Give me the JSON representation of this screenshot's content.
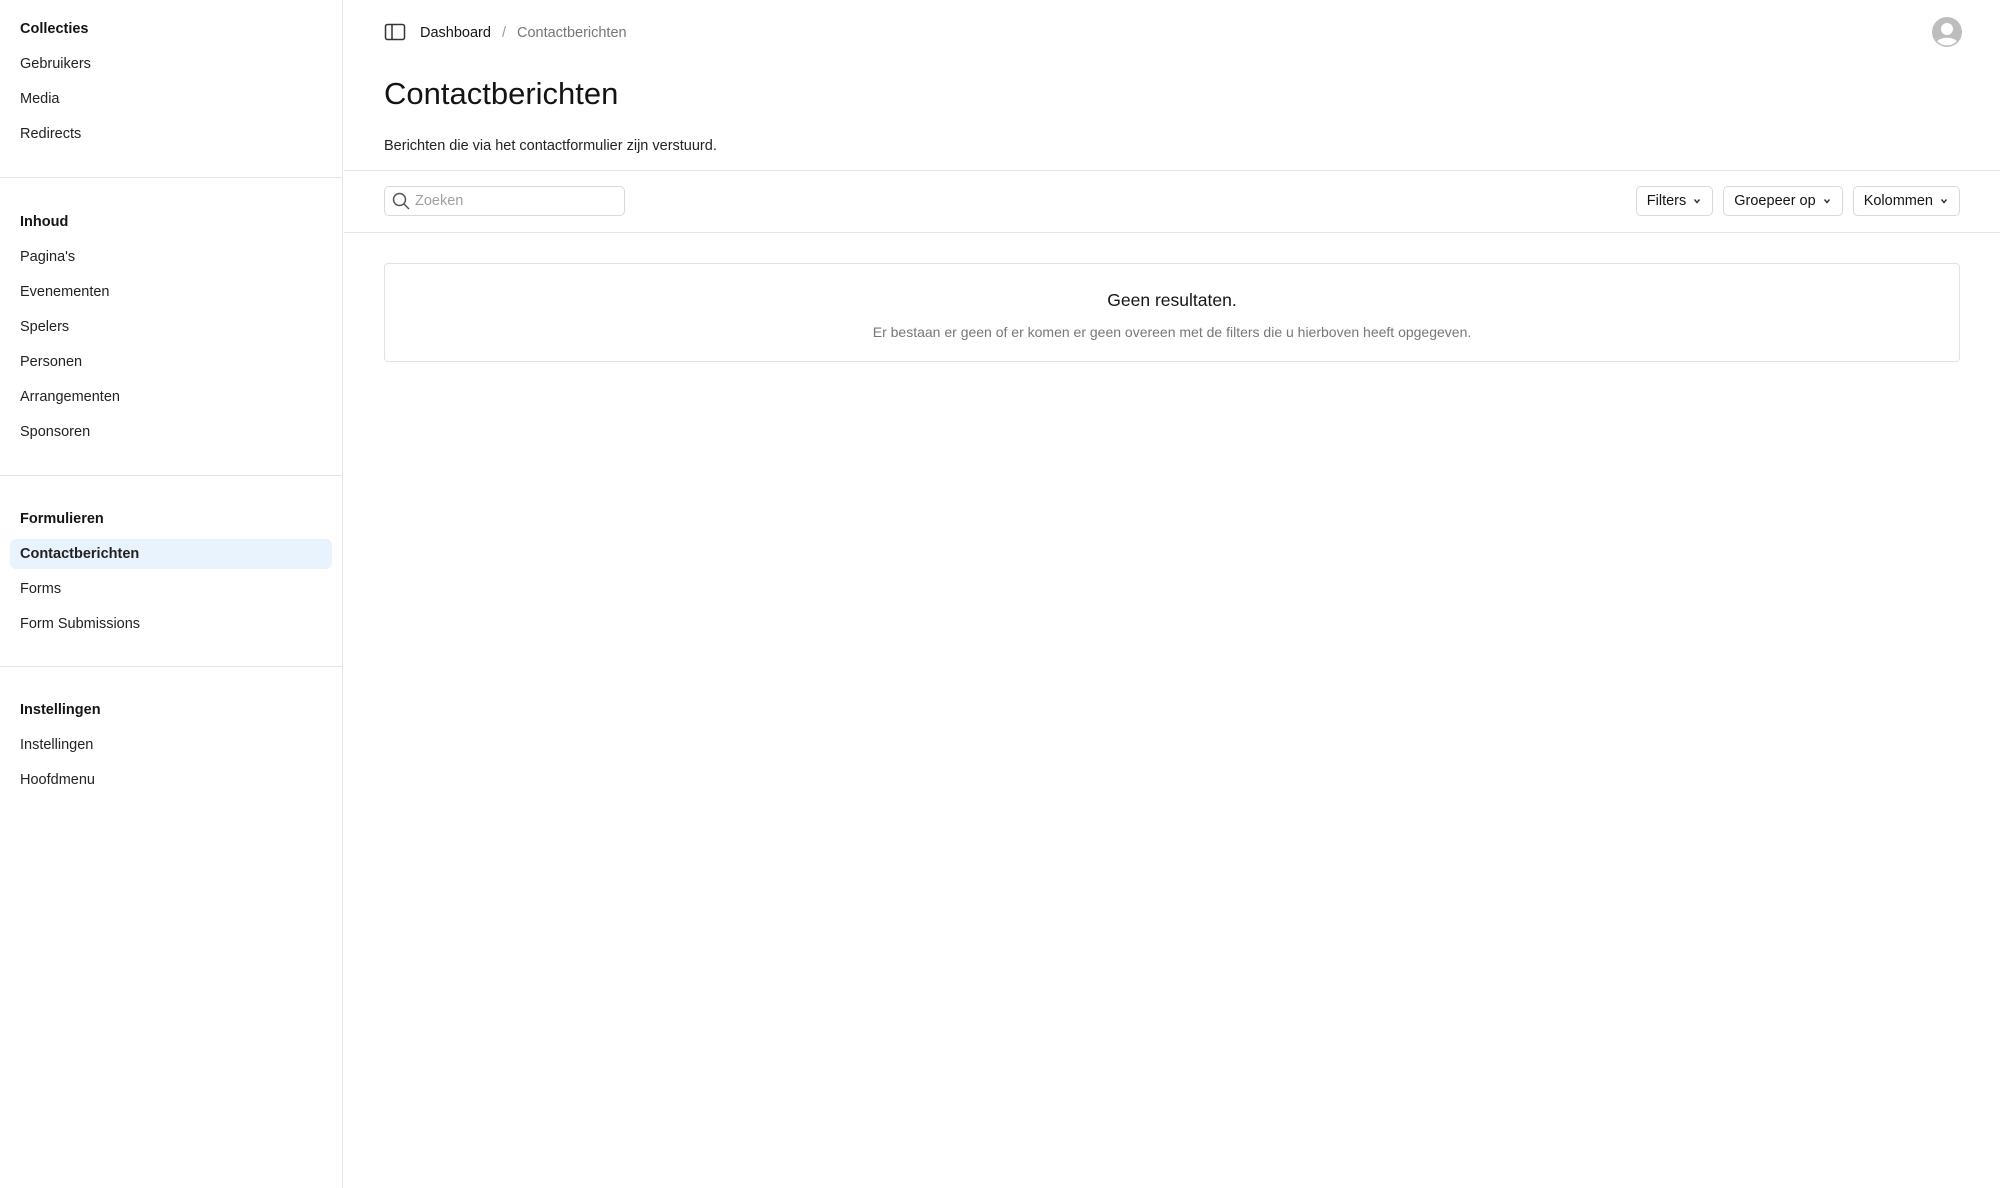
{
  "sidebar": {
    "groups": [
      {
        "heading": "Collecties",
        "items": [
          "Gebruikers",
          "Media",
          "Redirects"
        ]
      },
      {
        "heading": "Inhoud",
        "items": [
          "Pagina's",
          "Evenementen",
          "Spelers",
          "Personen",
          "Arrangementen",
          "Sponsoren"
        ]
      },
      {
        "heading": "Formulieren",
        "items": [
          "Contactberichten",
          "Forms",
          "Form Submissions"
        ]
      },
      {
        "heading": "Instellingen",
        "items": [
          "Instellingen",
          "Hoofdmenu"
        ]
      }
    ],
    "active_item": "Contactberichten"
  },
  "header": {
    "breadcrumb": {
      "root": "Dashboard",
      "separator": "/",
      "current": "Contactberichten"
    },
    "toggle_icon": "sidebar-toggle-icon",
    "avatar_icon": "user-avatar-icon"
  },
  "page": {
    "title": "Contactberichten",
    "description": "Berichten die via het contactformulier zijn verstuurd."
  },
  "toolbar": {
    "search_placeholder": "Zoeken",
    "search_value": "",
    "filters_label": "Filters",
    "group_label": "Groepeer op",
    "columns_label": "Kolommen"
  },
  "empty_state": {
    "title": "Geen resultaten.",
    "text": "Er bestaan er geen of er komen er geen overeen met de filters die u hierboven heeft opgegeven."
  },
  "colors": {
    "active_bg": "#e8f3fd",
    "border": "#e5e5e5",
    "muted_text": "#777777"
  }
}
